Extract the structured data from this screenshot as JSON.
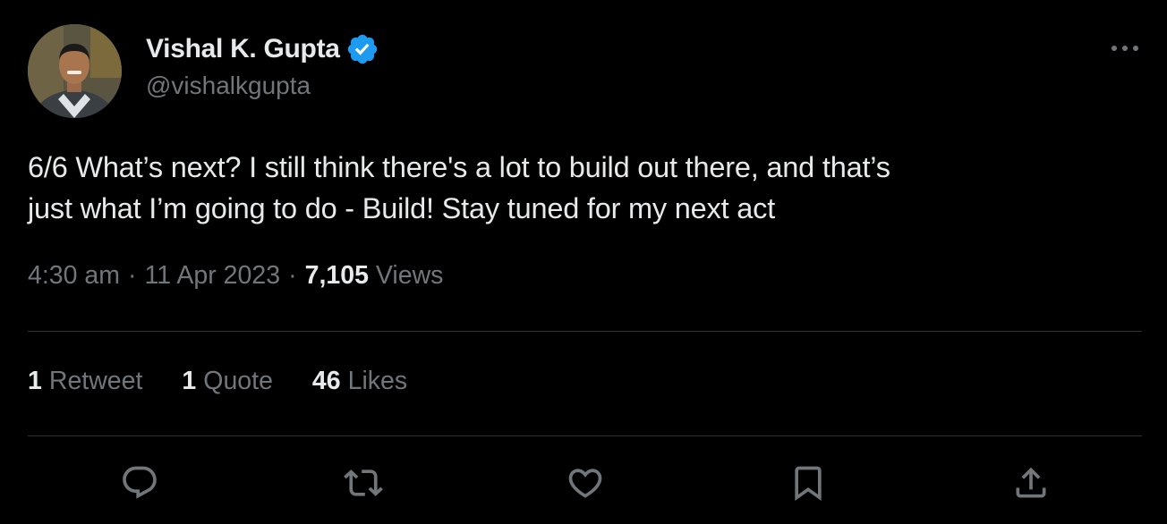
{
  "author": {
    "display_name": "Vishal K. Gupta",
    "handle": "@vishalkgupta",
    "verified": true
  },
  "tweet": {
    "text": "6/6 What’s next? I still think there's a lot to build out there, and that’s\njust what I’m going to do - Build! Stay tuned for my next act"
  },
  "meta": {
    "time": "4:30 am",
    "separator": "·",
    "date": "11 Apr 2023",
    "views_count": "7,105",
    "views_label": "Views"
  },
  "stats": [
    {
      "count": "1",
      "label": "Retweet"
    },
    {
      "count": "1",
      "label": "Quote"
    },
    {
      "count": "46",
      "label": "Likes"
    }
  ],
  "actions": [
    {
      "name": "reply",
      "icon": "reply-icon"
    },
    {
      "name": "retweet",
      "icon": "retweet-icon"
    },
    {
      "name": "like",
      "icon": "heart-icon"
    },
    {
      "name": "bookmark",
      "icon": "bookmark-icon"
    },
    {
      "name": "share",
      "icon": "share-icon"
    }
  ],
  "colors": {
    "background": "#000000",
    "primary_text": "#e7e9ea",
    "secondary_text": "#71767b",
    "divider": "#2f3336",
    "verified_badge": "#1d9bf0"
  }
}
